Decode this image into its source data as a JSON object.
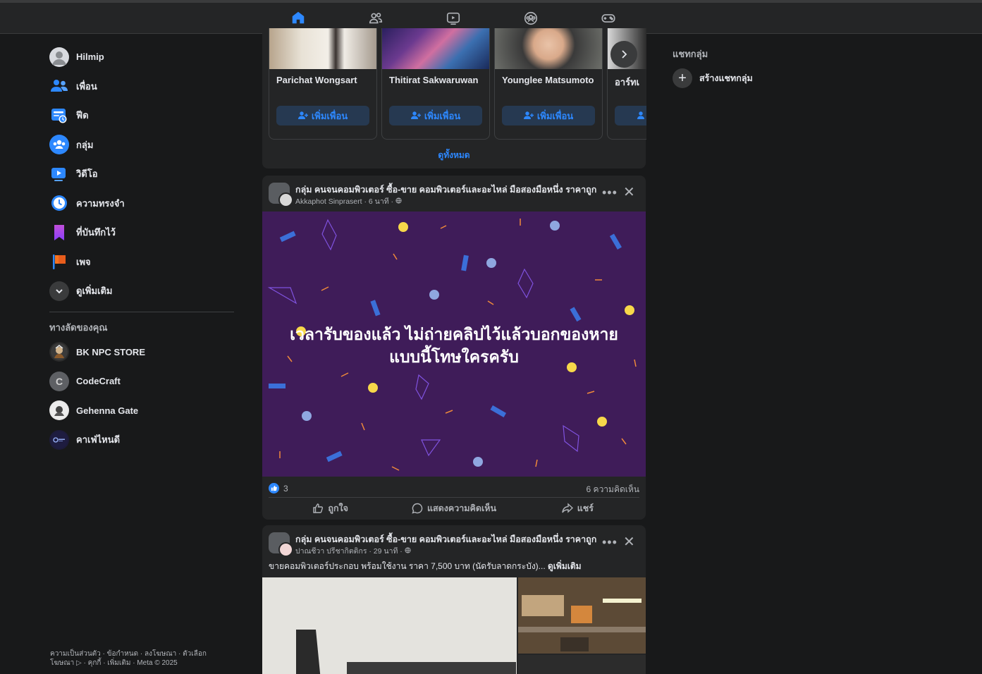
{
  "topnav": {
    "tabs": [
      {
        "name": "home-icon",
        "active": true
      },
      {
        "name": "friends-icon",
        "active": false
      },
      {
        "name": "video-icon",
        "active": false
      },
      {
        "name": "groups-icon",
        "active": false
      },
      {
        "name": "gaming-icon",
        "active": false
      }
    ],
    "accent": "#2d88ff"
  },
  "sidebar": {
    "items": [
      {
        "label": "Hilmip",
        "icon": "profile-avatar"
      },
      {
        "label": "เพื่อน",
        "icon": "friends-icon"
      },
      {
        "label": "ฟีด",
        "icon": "feed-icon"
      },
      {
        "label": "กลุ่ม",
        "icon": "groups-icon"
      },
      {
        "label": "วิดีโอ",
        "icon": "video-icon"
      },
      {
        "label": "ความทรงจำ",
        "icon": "memories-icon"
      },
      {
        "label": "ที่บันทึกไว้",
        "icon": "saved-icon"
      },
      {
        "label": "เพจ",
        "icon": "pages-icon"
      },
      {
        "label": "ดูเพิ่มเติม",
        "icon": "chevron-down-icon"
      }
    ],
    "shortcuts_title": "ทางลัดของคุณ",
    "shortcuts": [
      {
        "label": "BK NPC STORE"
      },
      {
        "label": "CodeCraft",
        "initial": "C"
      },
      {
        "label": "Gehenna Gate"
      },
      {
        "label": "คาเฟ่ไหนดี"
      }
    ],
    "footer": {
      "line1": "ความเป็นส่วนตัว · ข้อกำหนด · ลงโฆษณา · ตัวเลือก",
      "line2": "โฆษณา ▷ · คุกกี้ · เพิ่มเติม · Meta © 2025"
    }
  },
  "suggestions": {
    "people": [
      {
        "name": "Parichat Wongsart",
        "button": "เพิ่มเพื่อน"
      },
      {
        "name": "Thitirat Sakwaruwan",
        "button": "เพิ่มเพื่อน"
      },
      {
        "name": "Younglee Matsumoto",
        "button": "เพิ่มเพื่อน"
      },
      {
        "name": "อาร์ทเ",
        "button": ""
      }
    ],
    "see_all": "ดูทั้งหมด"
  },
  "post1": {
    "group": "กลุ่ม คนจนคอมพิวเตอร์ ซื้อ-ขาย คอมพิวเตอร์และอะไหล่ มือสองมือหนึ่ง ราคาถูก",
    "meta": "Akkaphot Sinprasert · 6 นาที · ",
    "text": "เวลารับของแล้ว ไม่ถ่ายคลิปไว้แล้วบอกของหายแบบนี้โทษใครครับ",
    "likes": "3",
    "comments": "6 ความคิดเห็น",
    "actions": {
      "like": "ถูกใจ",
      "comment": "แสดงความคิดเห็น",
      "share": "แชร์"
    },
    "bg_color": "#3f1c59"
  },
  "post2": {
    "group": "กลุ่ม คนจนคอมพิวเตอร์ ซื้อ-ขาย คอมพิวเตอร์และอะไหล่ มือสองมือหนึ่ง ราคาถูก",
    "meta": "ปาณชีวา ปรีชากิตติกร · 29 นาที · ",
    "body": "ขายคอมพิวเตอร์ประกอบ พร้อมใช้งาน ราคา 7,500 บาท (นัดรับลาดกระบัง)...",
    "see_more": "ดูเพิ่มเติม"
  },
  "right": {
    "title": "แชทกลุ่ม",
    "create": "สร้างแชทกลุ่ม"
  }
}
